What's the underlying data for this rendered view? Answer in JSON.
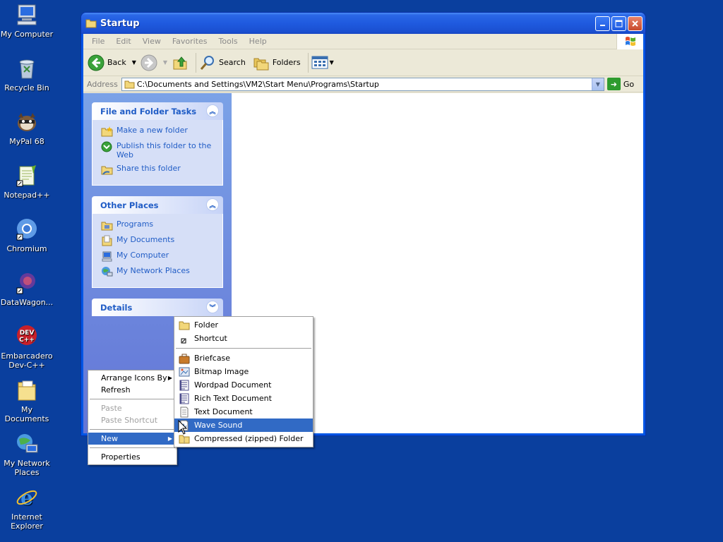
{
  "desktop": {
    "icons": [
      {
        "label": "My Computer"
      },
      {
        "label": "Recycle Bin"
      },
      {
        "label": "MyPal 68"
      },
      {
        "label": "Notepad++"
      },
      {
        "label": "Chromium"
      },
      {
        "label": "DataWagon..."
      },
      {
        "label": "Embarcadero Dev-C++"
      },
      {
        "label": "My Documents"
      },
      {
        "label": "My Network Places"
      },
      {
        "label": "Internet Explorer"
      }
    ]
  },
  "window": {
    "title": "Startup",
    "menu": [
      "File",
      "Edit",
      "View",
      "Favorites",
      "Tools",
      "Help"
    ],
    "toolbar": {
      "back": "Back",
      "search": "Search",
      "folders": "Folders"
    },
    "address": {
      "label": "Address",
      "value": "C:\\Documents and Settings\\VM2\\Start Menu\\Programs\\Startup",
      "go": "Go"
    },
    "taskpane": {
      "file_tasks": {
        "title": "File and Folder Tasks",
        "links": [
          "Make a new folder",
          "Publish this folder to the Web",
          "Share this folder"
        ]
      },
      "other_places": {
        "title": "Other Places",
        "links": [
          "Programs",
          "My Documents",
          "My Computer",
          "My Network Places"
        ]
      },
      "details": {
        "title": "Details"
      }
    }
  },
  "context_menu": {
    "items": [
      "Arrange Icons By",
      "Refresh",
      "Paste",
      "Paste Shortcut",
      "New",
      "Properties"
    ]
  },
  "new_submenu": {
    "items": [
      "Folder",
      "Shortcut",
      "Briefcase",
      "Bitmap Image",
      "Wordpad Document",
      "Rich Text Document",
      "Text Document",
      "Wave Sound",
      "Compressed (zipped) Folder"
    ],
    "highlighted": "Wave Sound"
  },
  "colors": {
    "desktop": "#0a3f9e",
    "highlight": "#316ac5",
    "link": "#215dc6"
  }
}
